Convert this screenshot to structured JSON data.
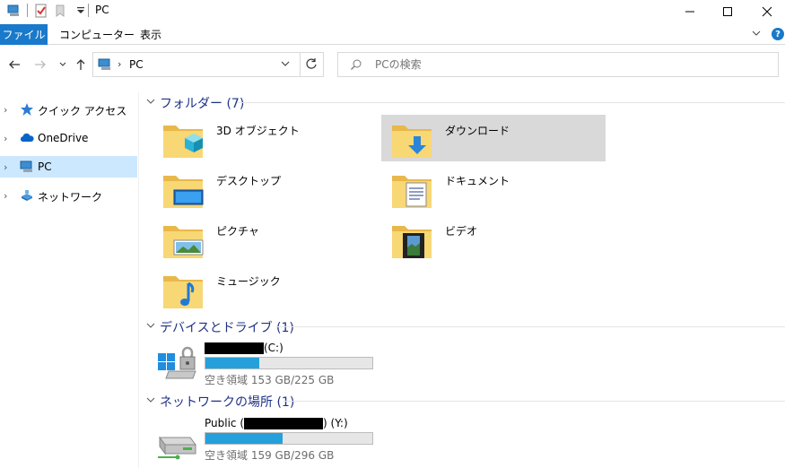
{
  "window": {
    "title": "PC"
  },
  "ribbon": {
    "tabs": [
      "ファイル",
      "コンピューター",
      "表示"
    ]
  },
  "address": {
    "location": "PC"
  },
  "search": {
    "placeholder": "PCの検索"
  },
  "sidebar": {
    "items": [
      {
        "label": "クイック アクセス",
        "icon": "quick-access-star-icon"
      },
      {
        "label": "OneDrive",
        "icon": "onedrive-cloud-icon"
      },
      {
        "label": "PC",
        "icon": "pc-icon",
        "selected": true
      },
      {
        "label": "ネットワーク",
        "icon": "network-icon"
      }
    ]
  },
  "folders": {
    "header": "フォルダー (7)",
    "items": [
      {
        "label": "3D オブジェクト",
        "icon": "3d-objects-folder-icon"
      },
      {
        "label": "ダウンロード",
        "icon": "downloads-folder-icon"
      },
      {
        "label": "デスクトップ",
        "icon": "desktop-folder-icon"
      },
      {
        "label": "ドキュメント",
        "icon": "documents-folder-icon"
      },
      {
        "label": "ピクチャ",
        "icon": "pictures-folder-icon"
      },
      {
        "label": "ビデオ",
        "icon": "videos-folder-icon"
      },
      {
        "label": "ミュージック",
        "icon": "music-folder-icon"
      }
    ]
  },
  "devices": {
    "header": "デバイスとドライブ (1)",
    "drive": {
      "label_suffix": "(C:)",
      "free_text": "空き領域 153 GB/225 GB",
      "used_fraction": 0.32
    }
  },
  "network": {
    "header": "ネットワークの場所 (1)",
    "drive": {
      "label_prefix": "Public (",
      "label_suffix": ") (Y:)",
      "free_text": "空き領域 159 GB/296 GB",
      "used_fraction": 0.46
    }
  },
  "colors": {
    "accent": "#1979ca",
    "selection": "#cce8ff",
    "hover": "#d9d9d9",
    "drive_bar": "#26a0da",
    "group_header": "#1e3287"
  }
}
